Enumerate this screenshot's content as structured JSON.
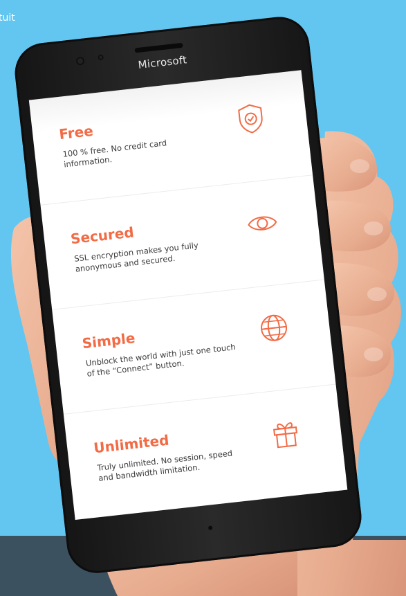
{
  "top_label": "tuit",
  "phone": {
    "brand": "Microsoft"
  },
  "features": [
    {
      "title": "Free",
      "description": "100 % free. No credit card information.",
      "icon": "shield-check-icon"
    },
    {
      "title": "Secured",
      "description": "SSL encryption makes you fully anonymous and secured.",
      "icon": "eye-icon"
    },
    {
      "title": "Simple",
      "description": "Unblock the world with just one touch of the “Connect” button.",
      "icon": "globe-icon"
    },
    {
      "title": "Unlimited",
      "description": "Truly unlimited. No session, speed and bandwidth limitation.",
      "icon": "gift-icon"
    }
  ],
  "colors": {
    "background": "#62c6f1",
    "accent": "#f26b45",
    "bottom_band": "#3c5160"
  }
}
